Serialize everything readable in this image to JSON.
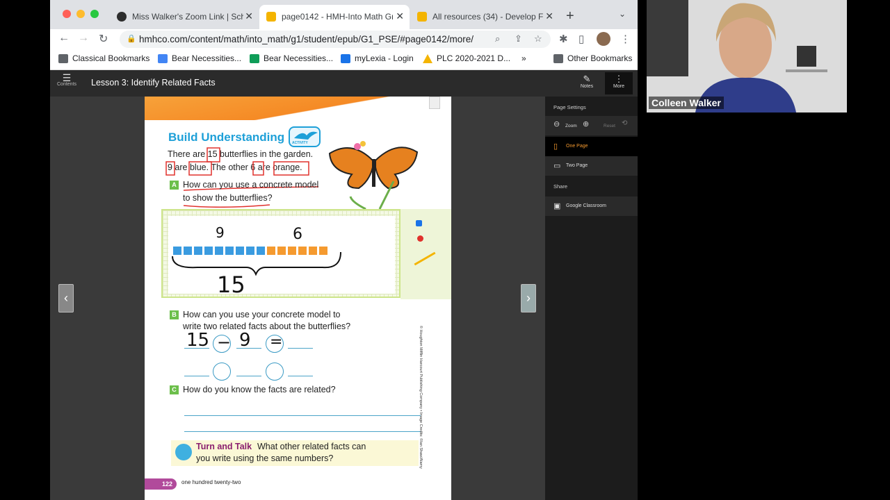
{
  "browser": {
    "tabs": [
      {
        "title": "Miss Walker's Zoom Link | Sch",
        "active": false,
        "favicon_color": "#2d2d2d"
      },
      {
        "title": "page0142 - HMH-Into Math Gr",
        "active": true,
        "favicon_color": "#f4b400"
      },
      {
        "title": "All resources (34) - Develop Fl",
        "active": false,
        "favicon_color": "#f4b400"
      }
    ],
    "new_tab": "+",
    "tab_menu": "⌄",
    "url": "hmhco.com/content/math/into_math/g1/student/epub/G1_PSE/#page0142/more/",
    "bookmarks": [
      {
        "label": "Classical Bookmarks",
        "color": "#5f6368"
      },
      {
        "label": "Bear Necessities...",
        "color": "#4285f4"
      },
      {
        "label": "Bear Necessities...",
        "color": "#0f9d58"
      },
      {
        "label": "myLexia - Login",
        "color": "#1a73e8"
      },
      {
        "label": "PLC 2020-2021 D...",
        "color": "#f4b400"
      }
    ],
    "bookmarks_overflow": "»",
    "other_bookmarks": "Other Bookmarks"
  },
  "app": {
    "contents_label": "Contents",
    "lesson_title": "Lesson 3: Identify Related Facts",
    "notes_label": "Notes",
    "more_label": "More"
  },
  "page": {
    "title": "Build Understanding",
    "activity_badge": "ACTIVITY",
    "intro_line1": "There are 15 butterflies in the garden.",
    "intro_line2": "9 are blue. The other 6 are orange.",
    "a_letter": "A",
    "a_line1": "How can you use a concrete model",
    "a_line2": "to show the butterflies?",
    "hw_top_left": "9",
    "hw_top_right": "6",
    "hw_total": "15",
    "b_letter": "B",
    "b_line1": "How can you use your concrete model to",
    "b_line2": "write two related facts about the butterflies?",
    "hw_fact_a": "15",
    "hw_op": "−",
    "hw_fact_b": "9",
    "hw_eq": "=",
    "c_letter": "C",
    "c_line": "How do you know the facts are related?",
    "tt_label": "Turn and Talk",
    "tt_line1": "What other related facts can",
    "tt_line2": "you write using the same numbers?",
    "page_number": "122",
    "page_words": "one hundred twenty-two",
    "copyright": "© Houghton Mifflin Harcourt Publishing Company • Image Credits: ©Ian Shaw/Alamy",
    "model": {
      "blue_cubes": 9,
      "orange_cubes": 6,
      "blue_color": "#3a9be0",
      "orange_color": "#f59a2f"
    }
  },
  "settings": {
    "page_settings": "Page Settings",
    "zoom": "Zoom",
    "reset": "Reset",
    "one_page": "One Page",
    "two_page": "Two Page",
    "share": "Share",
    "google_classroom": "Google Classroom"
  },
  "video": {
    "participant": "Colleen Walker"
  }
}
